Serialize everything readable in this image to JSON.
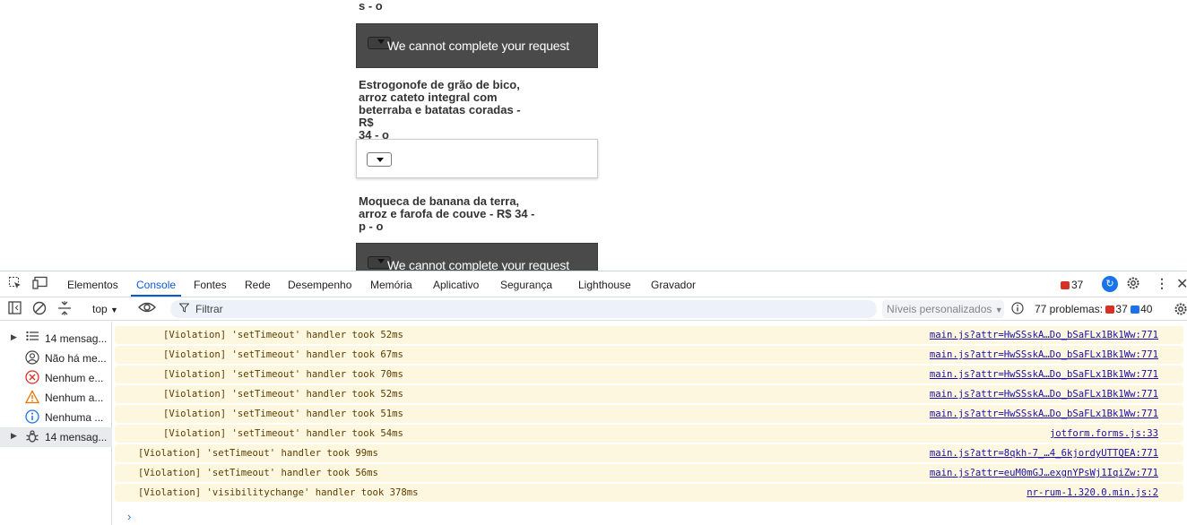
{
  "page": {
    "top_fragment": "s - o",
    "items": [
      {
        "kind": "dark",
        "message": "We cannot complete your request"
      },
      {
        "kind": "text",
        "lines": [
          "Estrogonofe de grão de bico,",
          "arroz cateto integral com",
          "beterraba e batatas coradas - R$",
          "34 - o"
        ]
      },
      {
        "kind": "light"
      },
      {
        "kind": "text",
        "lines": [
          "Moqueca de banana da terra,",
          "arroz e farofa de couve - R$ 34 -",
          "p - o"
        ]
      },
      {
        "kind": "dark",
        "message": "We cannot complete your request"
      }
    ]
  },
  "devtools": {
    "tabs": [
      "Elementos",
      "Console",
      "Fontes",
      "Rede",
      "Desempenho",
      "Memória",
      "Aplicativo",
      "Segurança",
      "Lighthouse",
      "Gravador"
    ],
    "active_tab": "Console",
    "error_badge_count": "37",
    "context_selector": "top",
    "filter_placeholder": "Filtrar",
    "levels_label": "Níveis personalizados",
    "problems_label": "77 problemas:",
    "problems_errors": "37",
    "problems_info": "40",
    "sidebar": [
      {
        "label": "14 mensag...",
        "icon": "list-icon",
        "expandable": true
      },
      {
        "label": "Não há me...",
        "icon": "user-icon",
        "expandable": false
      },
      {
        "label": "Nenhum e...",
        "icon": "error-icon",
        "expandable": false
      },
      {
        "label": "Nenhum a...",
        "icon": "warning-icon",
        "expandable": false
      },
      {
        "label": "Nenhuma ...",
        "icon": "info-icon",
        "expandable": false
      },
      {
        "label": "14 mensag...",
        "icon": "bug-icon",
        "expandable": true
      }
    ],
    "logs": [
      {
        "text": "[Violation] 'setTimeout' handler took 52ms",
        "source": "main.js?attr=HwSSskA…Do_bSaFLx1Bk1Ww:771",
        "indent": true
      },
      {
        "text": "[Violation] 'setTimeout' handler took 67ms",
        "source": "main.js?attr=HwSSskA…Do_bSaFLx1Bk1Ww:771",
        "indent": true
      },
      {
        "text": "[Violation] 'setTimeout' handler took 70ms",
        "source": "main.js?attr=HwSSskA…Do_bSaFLx1Bk1Ww:771",
        "indent": true
      },
      {
        "text": "[Violation] 'setTimeout' handler took 52ms",
        "source": "main.js?attr=HwSSskA…Do_bSaFLx1Bk1Ww:771",
        "indent": true
      },
      {
        "text": "[Violation] 'setTimeout' handler took 51ms",
        "source": "main.js?attr=HwSSskA…Do_bSaFLx1Bk1Ww:771",
        "indent": true
      },
      {
        "text": "[Violation] 'setTimeout' handler took 54ms",
        "source": "jotform.forms.js:33",
        "indent": true
      },
      {
        "text": "[Violation] 'setTimeout' handler took 99ms",
        "source": "main.js?attr=8qkh-7_…4_6kjordyUTTQEA:771",
        "indent": false
      },
      {
        "text": "[Violation] 'setTimeout' handler took 56ms",
        "source": "main.js?attr=euM0mGJ…exgnYPsWj1IqiZw:771",
        "indent": false
      },
      {
        "text": "[Violation] 'visibilitychange' handler took 378ms",
        "source": "nr-rum-1.320.0.min.js:2",
        "indent": false
      }
    ]
  }
}
